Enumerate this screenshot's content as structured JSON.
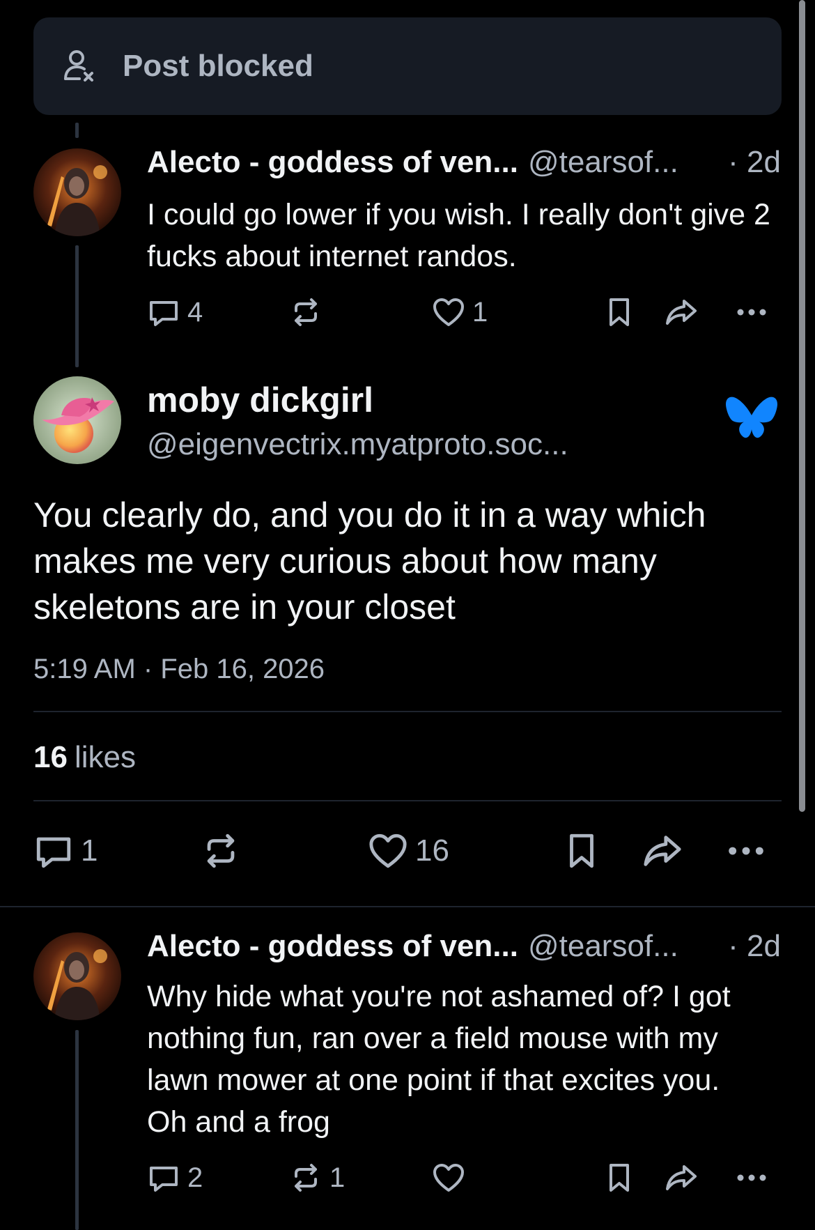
{
  "banner": {
    "label": "Post blocked",
    "icon": "person-x-icon"
  },
  "reply_top": {
    "author": "Alecto - goddess of ven...",
    "handle": "@tearsof...",
    "time": "· 2d",
    "text": "I could go lower if you wish. I really don't give 2 fucks about internet randos.",
    "replies": "4",
    "reposts": "",
    "likes": "1"
  },
  "main_post": {
    "author": "moby dickgirl",
    "handle": "@eigenvectrix.myatproto.soc...",
    "text": "You clearly do, and you do it in a way which makes me very curious about how many skeletons are in your closet",
    "timestamp": "5:19 AM · Feb 16, 2026",
    "likes_count": "16",
    "likes_label": "likes",
    "replies": "1",
    "reposts": "",
    "likes": "16",
    "badge_icon": "bluesky-butterfly-icon",
    "badge_color": "#1185fe"
  },
  "reply_bottom": {
    "author": "Alecto - goddess of ven...",
    "handle": "@tearsof...",
    "time": "· 2d",
    "text": "Why hide what you're not ashamed of? I got nothing fun, ran over a field mouse with my lawn mower at one point if that excites you. Oh and a frog",
    "replies": "2",
    "reposts": "1",
    "likes": ""
  }
}
